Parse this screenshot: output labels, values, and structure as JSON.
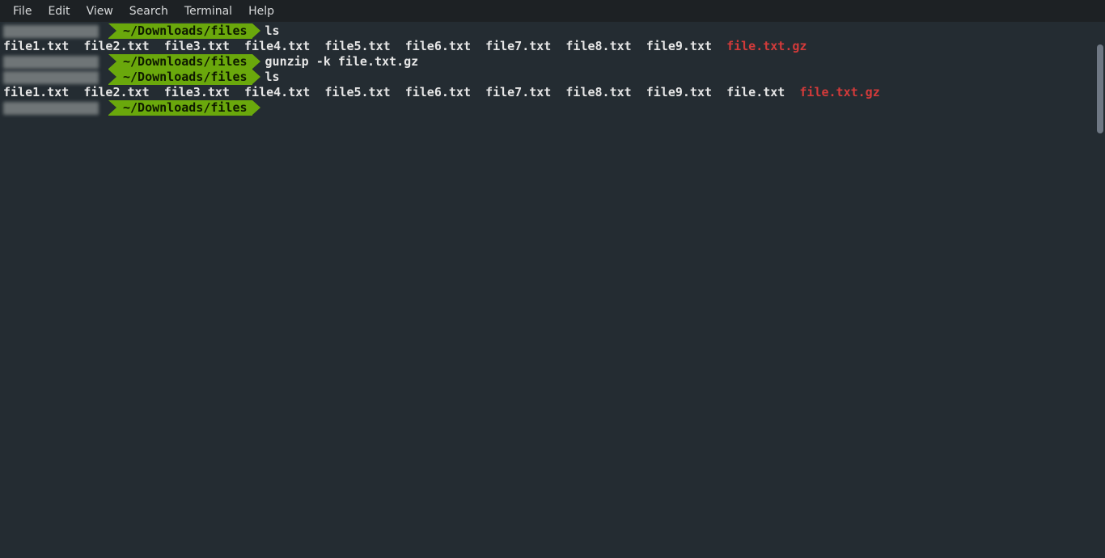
{
  "menu": {
    "items": [
      "File",
      "Edit",
      "View",
      "Search",
      "Terminal",
      "Help"
    ]
  },
  "prompt": {
    "path": "~/Downloads/files"
  },
  "session": [
    {
      "command": "ls",
      "output": [
        "file1.txt",
        "file2.txt",
        "file3.txt",
        "file4.txt",
        "file5.txt",
        "file6.txt",
        "file7.txt",
        "file8.txt",
        "file9.txt",
        "file.txt.gz"
      ]
    },
    {
      "command": "gunzip -k file.txt.gz",
      "output": []
    },
    {
      "command": "ls",
      "output": [
        "file1.txt",
        "file2.txt",
        "file3.txt",
        "file4.txt",
        "file5.txt",
        "file6.txt",
        "file7.txt",
        "file8.txt",
        "file9.txt",
        "file.txt",
        "file.txt.gz"
      ]
    }
  ],
  "colors": {
    "bg": "#242c32",
    "menubar_bg": "#1d2124",
    "prompt_bg": "#6aa80c",
    "text": "#e6e6e6",
    "gz": "#d23a3a"
  }
}
